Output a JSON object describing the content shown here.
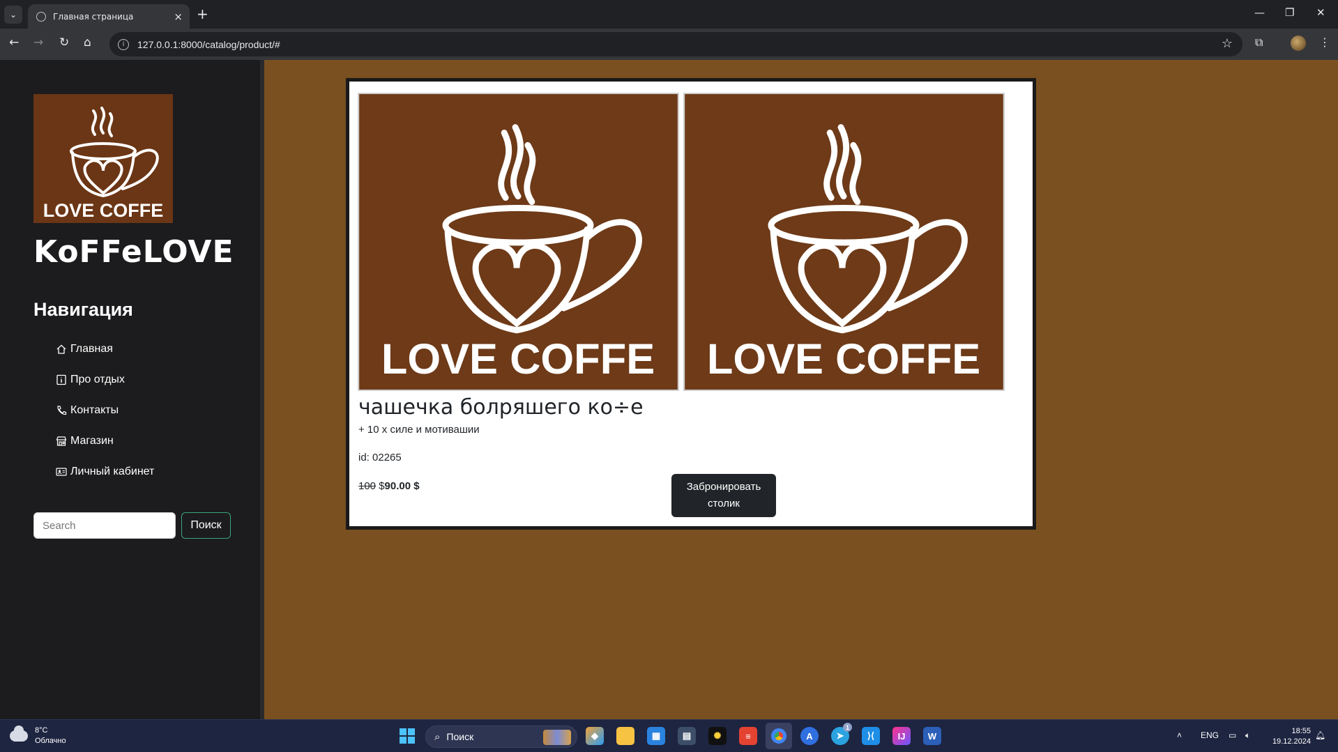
{
  "browser": {
    "tab_title": "Главная страница",
    "url": "127.0.0.1:8000/catalog/product/#",
    "new_tab_symbol": "+",
    "close_tab_symbol": "×"
  },
  "sidebar": {
    "logo_text": "LOVE COFFE",
    "brand_name": "KoFFeLOVE",
    "nav_title": "Навигация",
    "nav_items": [
      {
        "label": "Главная",
        "icon": "home-icon"
      },
      {
        "label": "Про отдых",
        "icon": "info-icon"
      },
      {
        "label": "Контакты",
        "icon": "phone-icon"
      },
      {
        "label": "Магазин",
        "icon": "shop-icon"
      },
      {
        "label": "Личный кабинет",
        "icon": "id-card-icon"
      }
    ],
    "search": {
      "placeholder": "Search",
      "button": "Поиск"
    }
  },
  "product": {
    "image_text": "LOVE COFFE",
    "title": "чашечка болряшего ко÷е",
    "description": "+ 10 х силе и мотивашии",
    "id_text": "id: 02265",
    "old_price": "100",
    "currency_sep": " $",
    "new_price": "90.00 $",
    "book_button_line1": "Забронировать",
    "book_button_line2": "столик"
  },
  "taskbar": {
    "weather_temp": "8°C",
    "weather_desc": "Облачно",
    "search_label": "Поиск",
    "lang": "ENG",
    "time": "18:55",
    "date": "19.12.2024",
    "telegram_badge": "1"
  },
  "colors": {
    "page_bg": "#7a5020",
    "sidebar_bg": "#1c1c1e",
    "logo_bg": "#6b3615",
    "button_dark": "#212529",
    "taskbar_bg": "#1e2541"
  }
}
